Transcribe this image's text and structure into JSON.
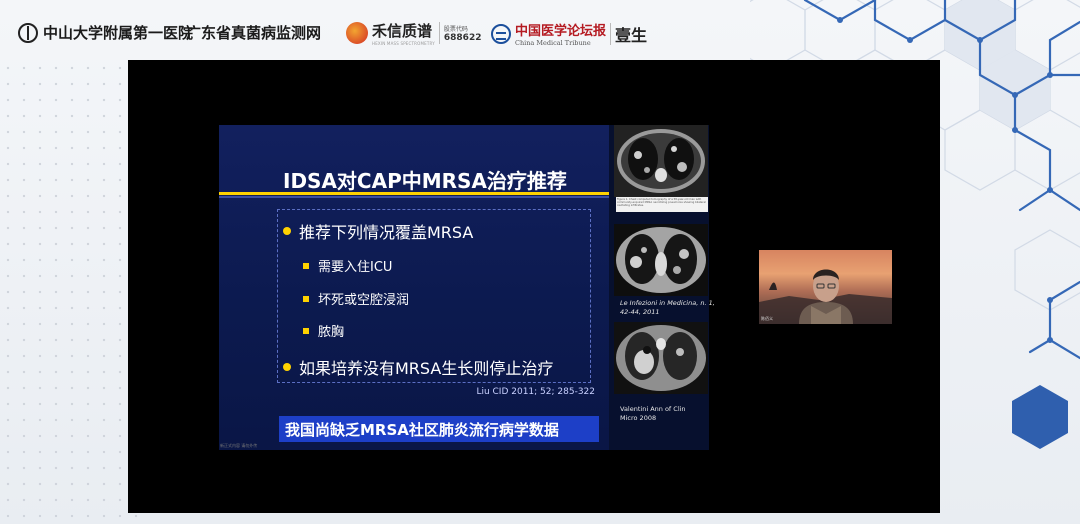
{
  "header": {
    "hospital": "中山大学附属第一医院",
    "network": "广东省真菌病监测网",
    "hexin": {
      "name": "禾信质谱",
      "sub": "HEXIN MASS SPECTROMETRY",
      "code_label": "股票代码",
      "code": "688622"
    },
    "cmt": {
      "name": "中国医学论坛报",
      "en": "China Medical Tribune",
      "yisheng": "壹生"
    }
  },
  "slide": {
    "title": "IDSA对CAP中MRSA治疗推荐",
    "bullet1": "推荐下列情况覆盖MRSA",
    "sub_bullets": [
      "需要入住ICU",
      "坏死或空腔浸润",
      "脓胸"
    ],
    "bullet2": "如果培养没有MRSA生长则停止治疗",
    "citation": "Liu CID 2011; 52; 285-322",
    "banner": "我国尚缺乏MRSA社区肺炎流行病学数据",
    "watermark": "新正式内容 请勿外传"
  },
  "images": {
    "caption1": "Figure 1. Chest computed tomography of a 58-year-old man with community-acquired MRSA necrotizing pneumonia showing bilateral cavitating infiltrates.",
    "caption2": [
      "Le Infezioni in Medicina, n. 1,",
      "42-44, 2011"
    ],
    "caption3": [
      "Valentini Ann of Clin",
      "Micro 2008"
    ]
  },
  "speaker": {
    "name_tag": "陈佰义"
  },
  "colors": {
    "slide_bg": "#12205e",
    "accent_yellow": "#ffd200",
    "banner_blue": "#1d3fc7",
    "hex_blue": "#2f5fae"
  }
}
